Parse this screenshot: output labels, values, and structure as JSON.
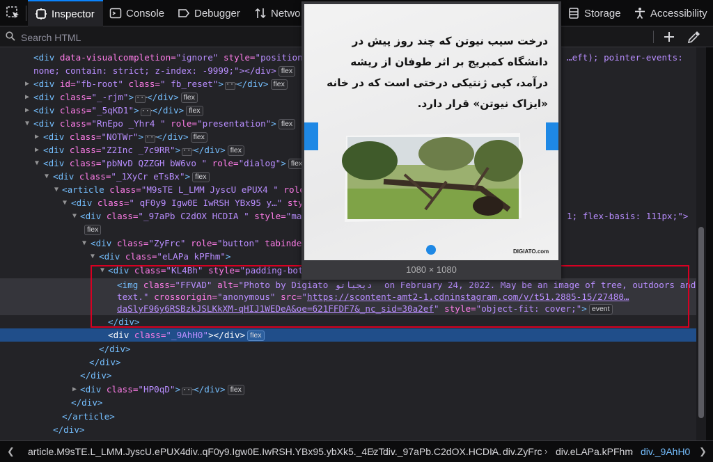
{
  "toolbar": {
    "tabs": [
      {
        "label": "Inspector"
      },
      {
        "label": "Console"
      },
      {
        "label": "Debugger"
      },
      {
        "label": "Netwo"
      },
      {
        "label": "Storage"
      },
      {
        "label": "Accessibility"
      }
    ]
  },
  "search": {
    "placeholder": "Search HTML"
  },
  "markup_lines": [
    [
      "<div ",
      "data-visualcompletion=",
      "\"ignore\"",
      " style=",
      "\"position:",
      "…eft); pointer-events:"
    ],
    [
      "none; contain: strict; z-index: -9999;\"></div>",
      "flex"
    ],
    [
      "<div ",
      "id=",
      "\"fb-root\"",
      " class=",
      "\" fb_reset\"",
      "</div>",
      "flex"
    ],
    [
      "<div ",
      "class=",
      "\"_-rjm\"",
      "</div>",
      "flex"
    ],
    [
      "<div ",
      "class=",
      "\"_5qKD1\"",
      "</div>",
      "flex"
    ],
    [
      "<div ",
      "class=",
      "\"RnEpo _Yhr4 \"",
      " role=",
      "\"presentation\"",
      ">",
      "flex"
    ],
    [
      "<div ",
      "class=",
      "\"NOTWr\"",
      "</div>",
      "flex"
    ],
    [
      "<div ",
      "class=",
      "\"Z2Inc _7c9RR\"",
      "</div>",
      "flex"
    ],
    [
      "<div ",
      "class=",
      "\"pbNvD QZZGH bW6vo \"",
      " role=",
      "\"dialog\"",
      ">",
      "flex"
    ],
    [
      "<div ",
      "class=",
      "\"_1XyCr eTsBx\"",
      ">",
      "flex"
    ],
    [
      "<article ",
      "class=",
      "\"M9sTE L_LMM JyscU ePUX4 \"",
      " role="
    ],
    [
      "<div ",
      "class=",
      "\" qF0y9 Igw0E IwRSH YBx95 y…\"",
      " sty"
    ],
    [
      "<div ",
      "class=",
      "\"_97aPb C2dOX HCDIA \"",
      " style=",
      "\"max",
      "1; flex-basis: 111px;\">"
    ],
    [
      "flex"
    ],
    [
      "<div ",
      "class=",
      "\"ZyFrc\"",
      " role=",
      "\"button\"",
      " tabindex="
    ],
    [
      "<div ",
      "class=",
      "\"eLAPa kPFhm\"",
      ">"
    ],
    [
      "<div ",
      "class=",
      "\"KL4Bh\"",
      " style=",
      "\"padding-bott"
    ],
    [
      "<img ",
      "class=",
      "\"FFVAD\"",
      " alt=",
      "\"Photo by Digiato",
      "دیجیاتو",
      " on February 24, 2022. May be an image of tree, outdoors and"
    ],
    [
      "text.\"",
      " crossorigin=",
      "\"anonymous\"",
      " src=",
      "\"",
      "https://scontent-amt2-1.cdninstagram.com/v/t51.2885-15/27480…"
    ],
    [
      "daSlyF96y6RSBzkJSLKkXM-qHIJ1WEDeA&oe=621FFDF7&_nc_sid=30a2ef",
      "\"",
      " style=",
      "\"object-fit: cover;\"",
      ">",
      "event"
    ],
    [
      "</div>"
    ],
    [
      "<div ",
      "class=",
      "\"_9AhH0\"",
      "></div>",
      "flex"
    ],
    [
      "</div>"
    ],
    [
      "</div>"
    ],
    [
      "</div>"
    ],
    [
      "<div ",
      "class=",
      "\"HP0qD\"",
      "</div>",
      "flex"
    ],
    [
      "</div>"
    ],
    [
      "</article>"
    ],
    [
      "</div>"
    ]
  ],
  "preview": {
    "caption_fa": "درخت سیب نیوتن که چند روز پیش در دانشگاه کمبریج بر اثر طوفان از ریشه درآمد، کپی ژنتیکی درختی است که در خانه «ایزاک نیوتن» قرار دارد.",
    "brand": "DIGIATO.com",
    "dimensions": "1080 × 1080"
  },
  "breadcrumbs": [
    "article.M9sTE.L_LMM.JyscU.ePUX4.",
    "div..qF0y9.Igw0E.IwRSH.YBx95.ybXk5._4EzT…",
    "div._97aPb.C2dOX.HCDIA.",
    "div.ZyFrc",
    "div.eLAPa.kPFhm",
    "div._9AhH0"
  ],
  "colors": {
    "tag": "#75bfff",
    "attr_name": "#ff7de9",
    "attr_value": "#b98eff",
    "selection": "#204e8a",
    "highlight_box": "#d70022",
    "accent": "#0a84ff"
  }
}
